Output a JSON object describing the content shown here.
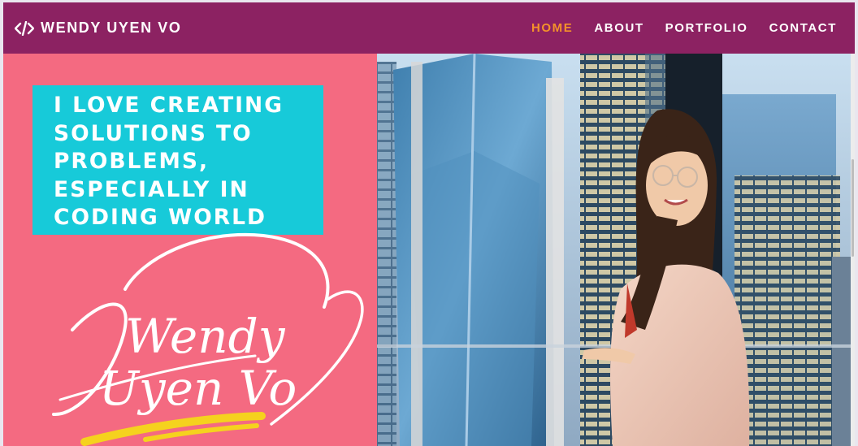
{
  "brand": {
    "icon": "code-icon",
    "name": "WENDY UYEN VO"
  },
  "nav": {
    "items": [
      {
        "label": "HOME",
        "active": true
      },
      {
        "label": "ABOUT",
        "active": false
      },
      {
        "label": "PORTFOLIO",
        "active": false
      },
      {
        "label": "CONTACT",
        "active": false
      }
    ]
  },
  "hero": {
    "headline_lines": [
      "I LOVE CREATING",
      "SOLUTIONS TO",
      "PROBLEMS,",
      "ESPECIALLY IN",
      "CODING WORLD"
    ],
    "signature_line1": "Wendy",
    "signature_line2": "Uyen Vo"
  },
  "colors": {
    "navbar": "#8c2262",
    "accent_active": "#f4922a",
    "hero_pink": "#f46a81",
    "headline_box": "#17cad9",
    "signature_stroke": "#f5d21e"
  }
}
